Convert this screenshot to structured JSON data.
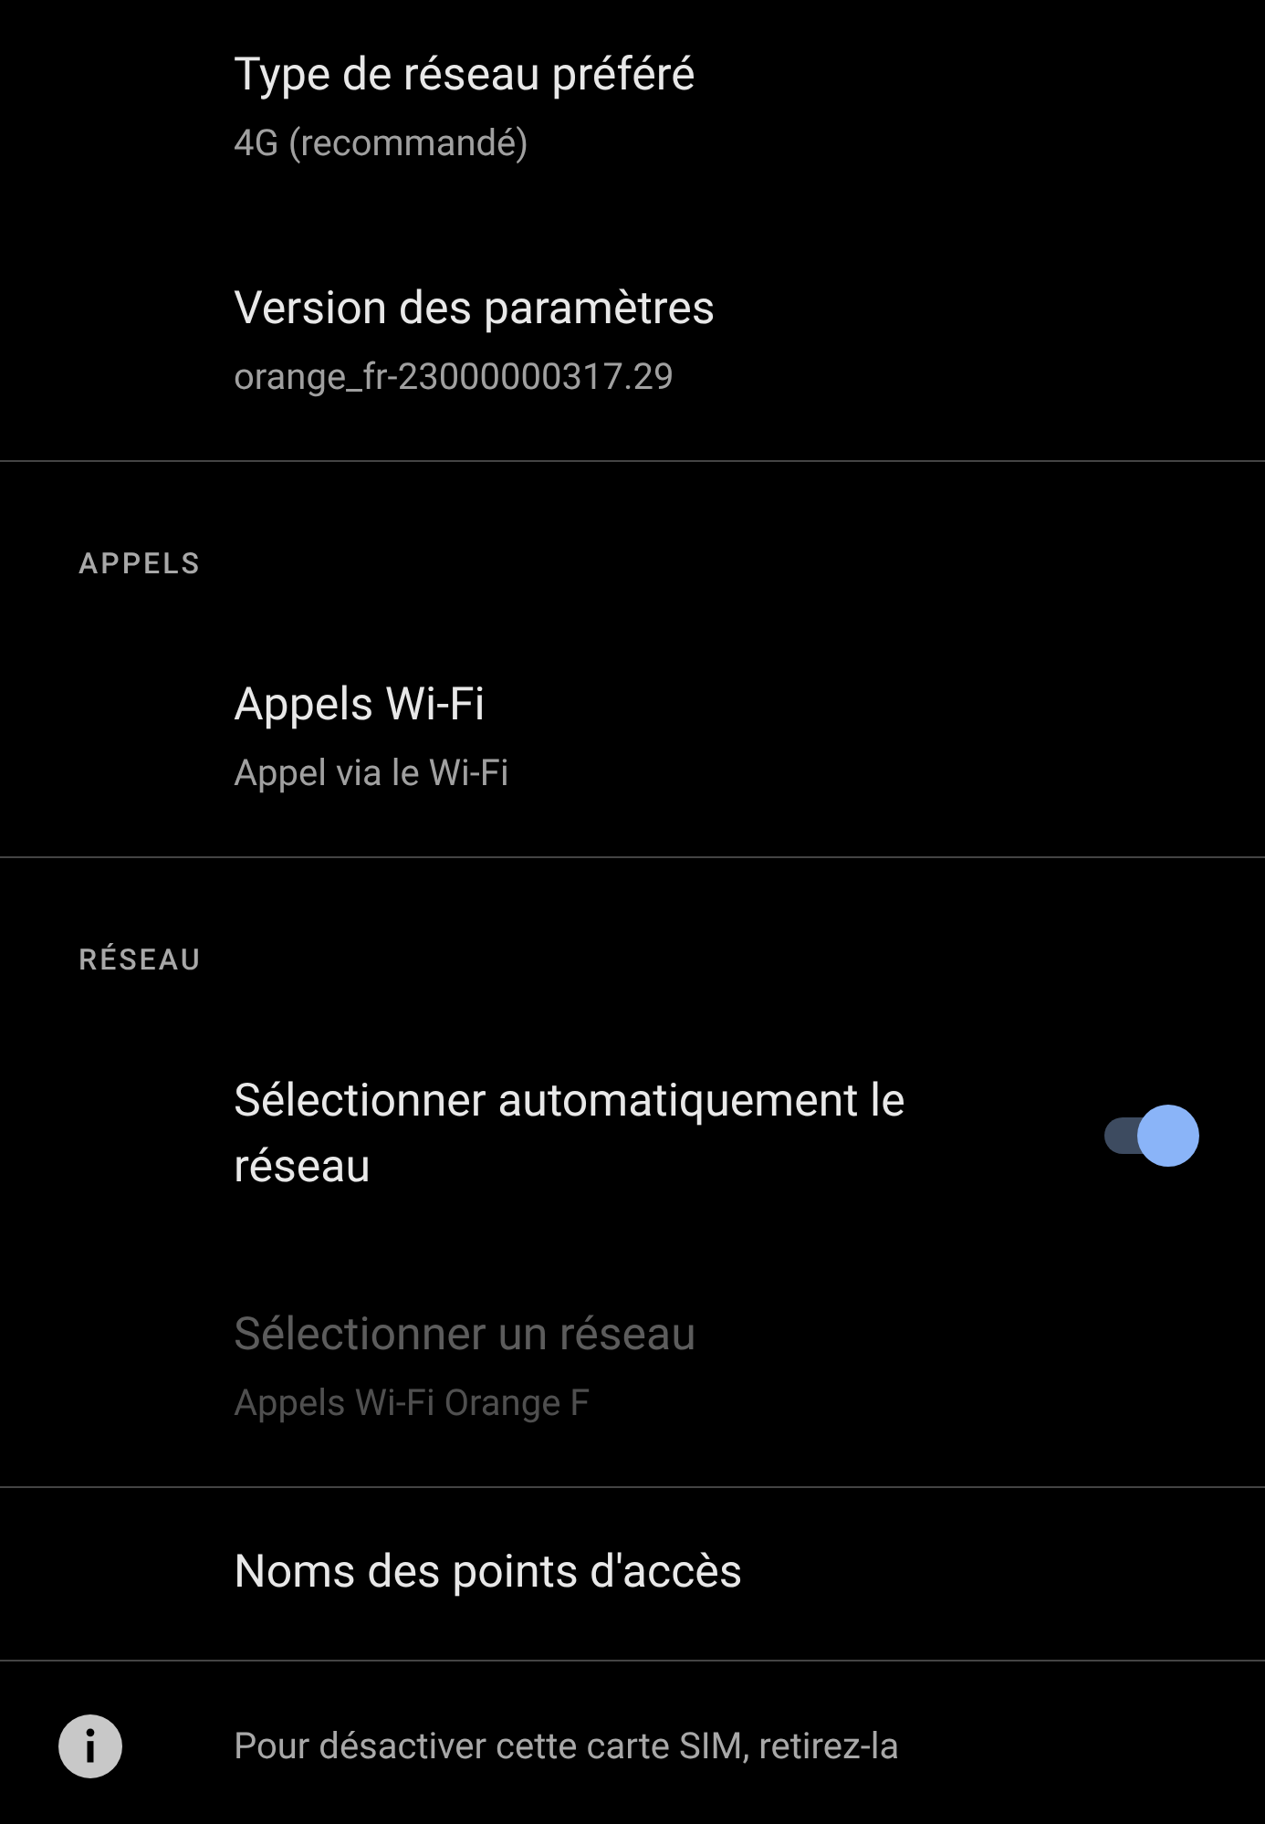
{
  "sections": [
    {
      "items": [
        {
          "kind": "text",
          "title": "Type de réseau préféré",
          "subtitle": "4G (recommandé)",
          "disabled": false
        },
        {
          "kind": "text",
          "title": "Version des paramètres",
          "subtitle": "orange_fr-23000000317.29",
          "disabled": false
        }
      ]
    },
    {
      "header": "APPELS",
      "items": [
        {
          "kind": "text",
          "title": "Appels Wi-Fi",
          "subtitle": "Appel via le Wi-Fi",
          "disabled": false
        }
      ]
    },
    {
      "header": "RÉSEAU",
      "items": [
        {
          "kind": "switch",
          "title": "Sélectionner automatiquement le réseau",
          "on": true,
          "disabled": false
        },
        {
          "kind": "text",
          "title": "Sélectionner un réseau",
          "subtitle": "Appels Wi-Fi Orange F",
          "disabled": true
        }
      ]
    },
    {
      "items": [
        {
          "kind": "text",
          "title": "Noms des points d'accès",
          "disabled": false
        }
      ]
    }
  ],
  "footer": {
    "text": "Pour désactiver cette carte SIM, retirez-la"
  }
}
